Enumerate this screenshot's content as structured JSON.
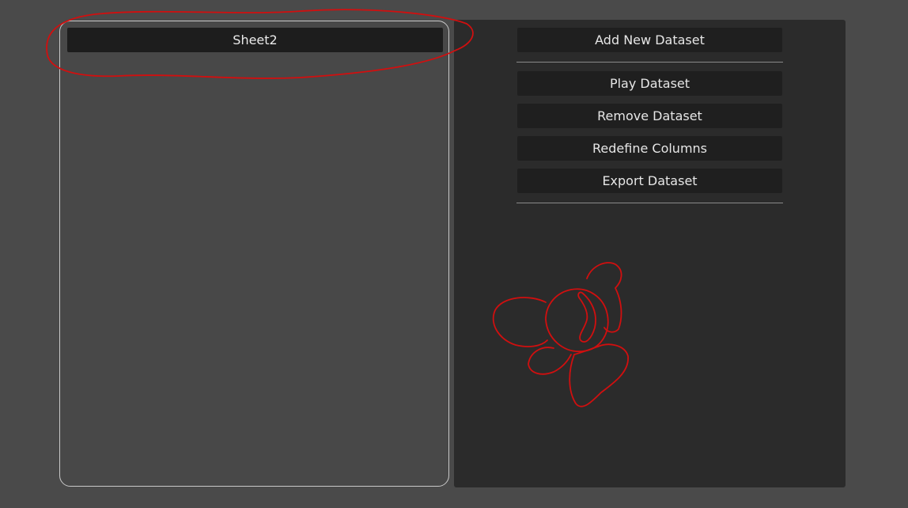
{
  "dataset_list": {
    "items": [
      {
        "label": "Sheet2"
      }
    ]
  },
  "actions": {
    "add_label": "Add New Dataset",
    "play_label": "Play Dataset",
    "remove_label": "Remove Dataset",
    "redefine_label": "Redefine Columns",
    "export_label": "Export Dataset"
  },
  "annotation": {
    "color": "#d10f0f"
  }
}
